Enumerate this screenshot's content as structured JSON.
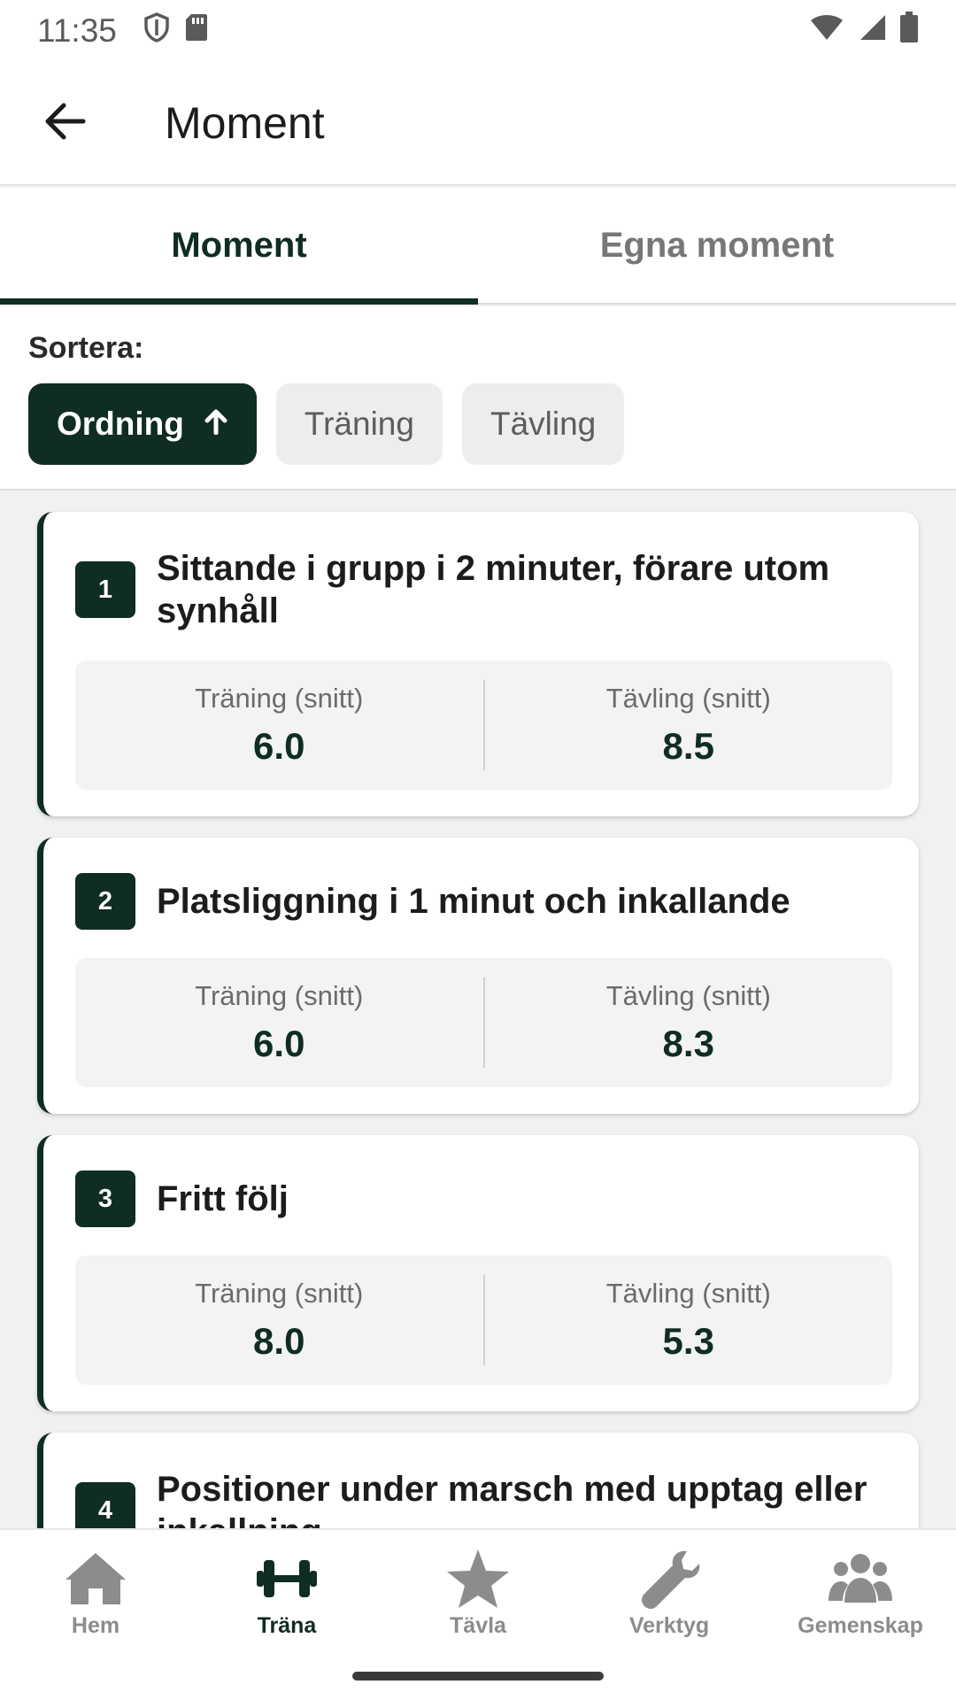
{
  "status_bar": {
    "time": "11:35"
  },
  "app_bar": {
    "title": "Moment"
  },
  "tabs": [
    {
      "label": "Moment",
      "active": true
    },
    {
      "label": "Egna moment",
      "active": false
    }
  ],
  "sort": {
    "label": "Sortera:",
    "chips": [
      {
        "label": "Ordning",
        "active": true,
        "icon": "arrow-up-icon"
      },
      {
        "label": "Träning",
        "active": false
      },
      {
        "label": "Tävling",
        "active": false
      }
    ]
  },
  "moments": [
    {
      "number": "1",
      "title": "Sittande i grupp i 2 minuter, förare utom synhåll",
      "training_label": "Träning (snitt)",
      "training_value": "6.0",
      "competition_label": "Tävling (snitt)",
      "competition_value": "8.5"
    },
    {
      "number": "2",
      "title": "Platsliggning i 1 minut och inkallande",
      "training_label": "Träning (snitt)",
      "training_value": "6.0",
      "competition_label": "Tävling (snitt)",
      "competition_value": "8.3"
    },
    {
      "number": "3",
      "title": "Fritt följ",
      "training_label": "Träning (snitt)",
      "training_value": "8.0",
      "competition_label": "Tävling (snitt)",
      "competition_value": "5.3"
    },
    {
      "number": "4",
      "title": "Positioner under marsch med upptag eller inkallning"
    }
  ],
  "bottom_nav": [
    {
      "label": "Hem",
      "icon": "home-icon",
      "active": false
    },
    {
      "label": "Träna",
      "icon": "dumbbell-icon",
      "active": true
    },
    {
      "label": "Tävla",
      "icon": "star-icon",
      "active": false
    },
    {
      "label": "Verktyg",
      "icon": "wrench-icon",
      "active": false
    },
    {
      "label": "Gemenskap",
      "icon": "people-icon",
      "active": false
    }
  ],
  "colors": {
    "primary": "#0f2d22",
    "inactive": "#8c8c8c"
  }
}
